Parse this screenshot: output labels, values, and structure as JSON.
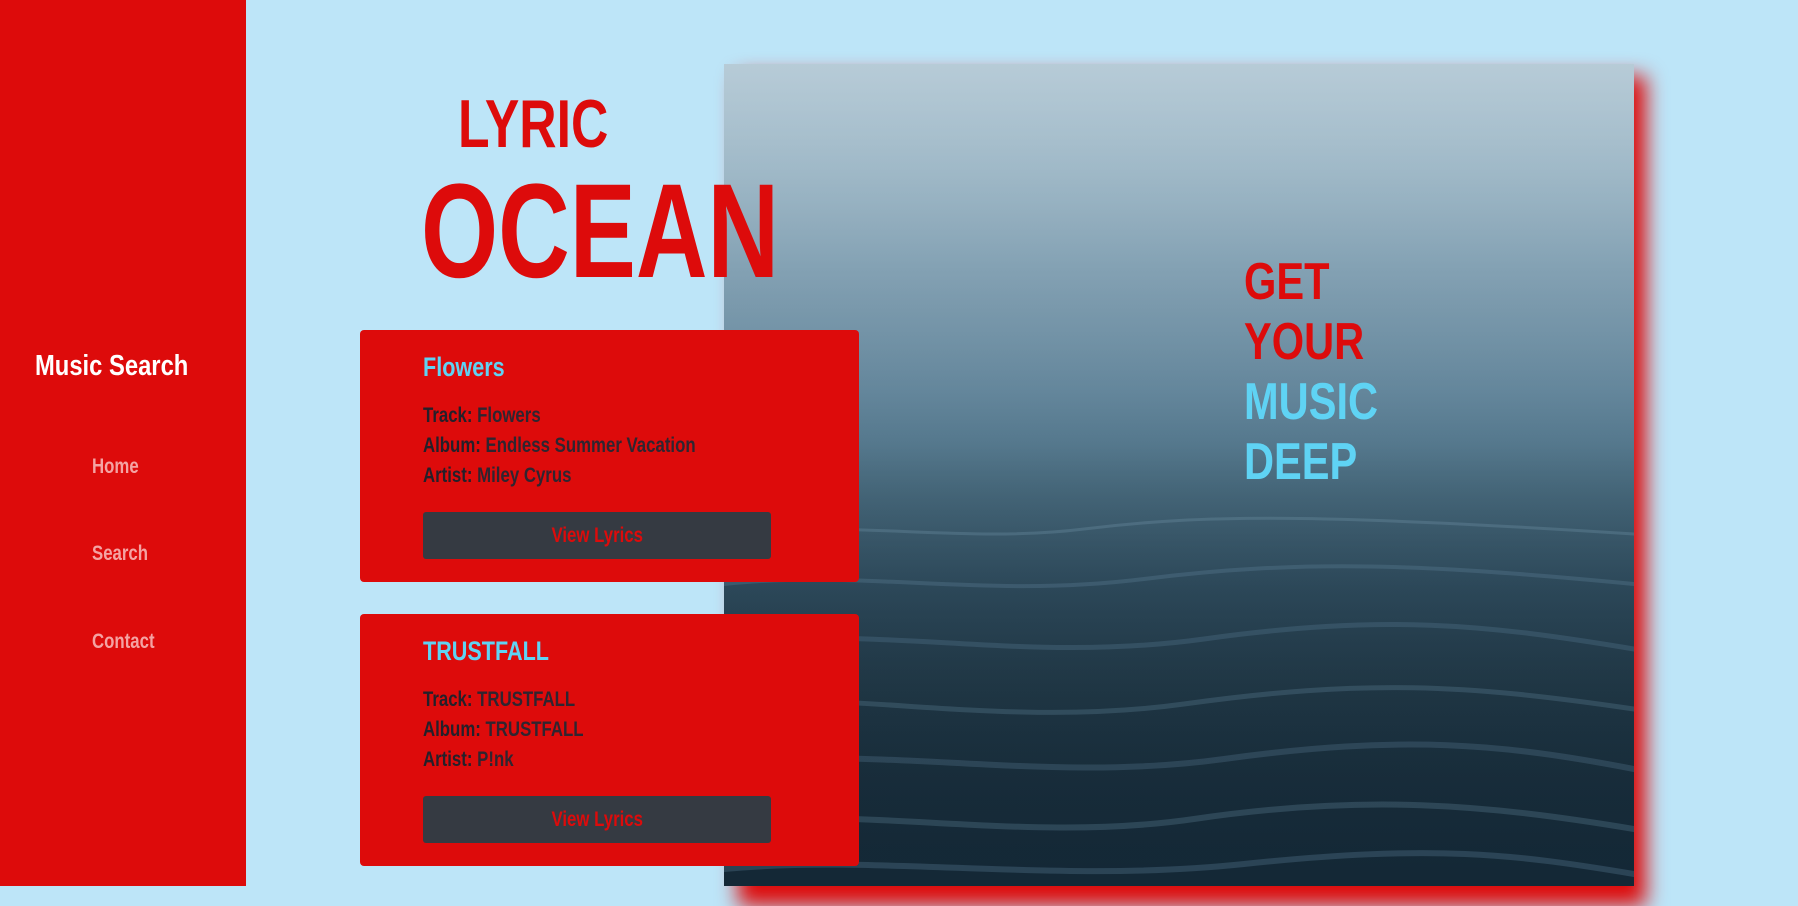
{
  "sidebar": {
    "title": "Music Search",
    "nav": [
      {
        "label": "Home"
      },
      {
        "label": "Search"
      },
      {
        "label": "Contact"
      }
    ]
  },
  "header": {
    "title_top": "LYRIC",
    "title_main": "OCEAN"
  },
  "hero": {
    "tagline": [
      {
        "text": "GET",
        "color": "#dd0b0b"
      },
      {
        "text": "YOUR",
        "color": "#dd0b0b"
      },
      {
        "text": "MUSIC",
        "color": "#5fd3f4"
      },
      {
        "text": "DEEP",
        "color": "#5fd3f4"
      }
    ]
  },
  "results": [
    {
      "title": "Flowers",
      "track_label": "Track:",
      "track": "Flowers",
      "album_label": "Album:",
      "album": "Endless Summer Vacation",
      "artist_label": "Artist:",
      "artist": "Miley Cyrus",
      "button": "View Lyrics"
    },
    {
      "title": "TRUSTFALL",
      "track_label": "Track:",
      "track": "TRUSTFALL",
      "album_label": "Album:",
      "album": "TRUSTFALL",
      "artist_label": "Artist:",
      "artist": "P!nk",
      "button": "View Lyrics"
    }
  ],
  "colors": {
    "accent_red": "#dd0b0b",
    "accent_cyan": "#5fd3f4",
    "page_background": "#bde5f8",
    "button_dark": "#353a42"
  }
}
